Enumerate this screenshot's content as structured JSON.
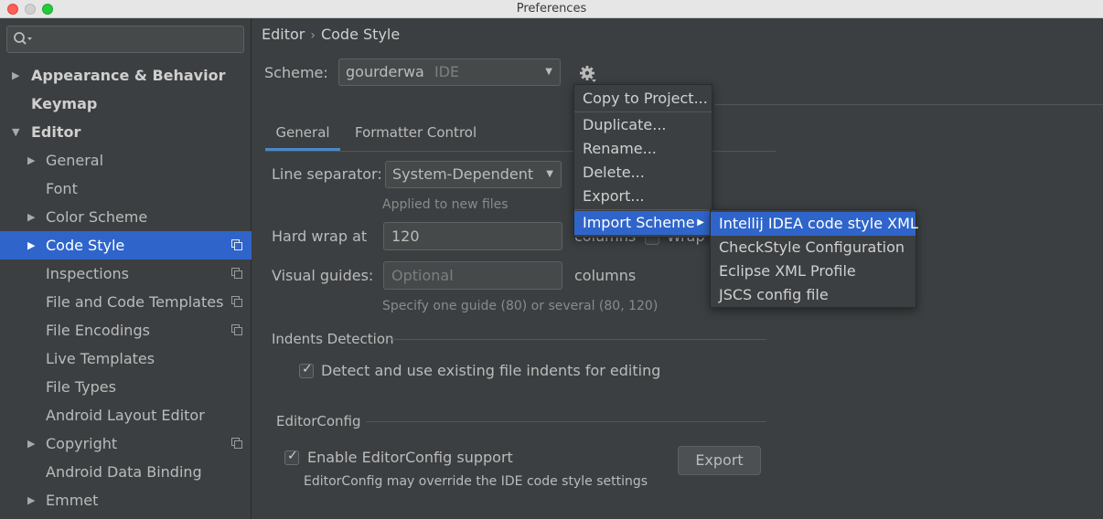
{
  "window": {
    "title": "Preferences"
  },
  "sidebar": {
    "search": {
      "placeholder": ""
    },
    "items": [
      {
        "label": "Appearance & Behavior",
        "expand": "▶",
        "bold": true
      },
      {
        "label": "Keymap",
        "expand": "",
        "bold": true
      },
      {
        "label": "Editor",
        "expand": "▼",
        "bold": true
      },
      {
        "label": "General",
        "expand": "▶"
      },
      {
        "label": "Font",
        "expand": ""
      },
      {
        "label": "Color Scheme",
        "expand": "▶"
      },
      {
        "label": "Code Style",
        "expand": "▶",
        "selected": true,
        "project_icon": true
      },
      {
        "label": "Inspections",
        "expand": "",
        "project_icon": true
      },
      {
        "label": "File and Code Templates",
        "expand": "",
        "project_icon": true
      },
      {
        "label": "File Encodings",
        "expand": "",
        "project_icon": true
      },
      {
        "label": "Live Templates",
        "expand": ""
      },
      {
        "label": "File Types",
        "expand": ""
      },
      {
        "label": "Android Layout Editor",
        "expand": ""
      },
      {
        "label": "Copyright",
        "expand": "▶",
        "project_icon": true
      },
      {
        "label": "Android Data Binding",
        "expand": ""
      },
      {
        "label": "Emmet",
        "expand": "▶"
      }
    ]
  },
  "breadcrumb": {
    "parent": "Editor",
    "separator": "›",
    "current": "Code Style"
  },
  "scheme": {
    "label": "Scheme:",
    "name": "gourderwa",
    "type": "IDE",
    "dropdown_icon": "▼"
  },
  "tabs": [
    {
      "label": "General",
      "active": true
    },
    {
      "label": "Formatter Control",
      "active": false
    }
  ],
  "general": {
    "line_separator": {
      "label": "Line separator:",
      "value": "System-Dependent",
      "hint": "Applied to new files"
    },
    "hard_wrap": {
      "label": "Hard wrap at",
      "value": "120",
      "unit": "columns",
      "wrap_label": "Wrap o"
    },
    "visual_guides": {
      "label": "Visual guides:",
      "placeholder": "Optional",
      "unit": "columns",
      "hint": "Specify one guide (80) or several (80, 120)"
    },
    "indents_detection": {
      "title": "Indents Detection",
      "checkbox_label": "Detect and use existing file indents for editing",
      "checked": true
    },
    "editorconfig": {
      "title": "EditorConfig",
      "checkbox_label": "Enable EditorConfig support",
      "checked": true,
      "hint": "EditorConfig may override the IDE code style settings",
      "export_label": "Export"
    }
  },
  "scheme_menu": {
    "items": [
      "Copy to Project...",
      "Duplicate...",
      "Rename...",
      "Delete...",
      "Export..."
    ],
    "import_item": "Import Scheme",
    "submenu_arrow": "▶",
    "import_submenu": [
      "Intellij IDEA code style XML",
      "CheckStyle Configuration",
      "Eclipse XML Profile",
      "JSCS config file"
    ]
  },
  "colors": {
    "selection": "#2f65ca",
    "tab_underline": "#4a88c7",
    "background": "#3c3f41"
  },
  "icons": {
    "search": "search-icon",
    "settings": "gear-icon",
    "project_scope": "copy-icon",
    "checkmark": "✓"
  }
}
